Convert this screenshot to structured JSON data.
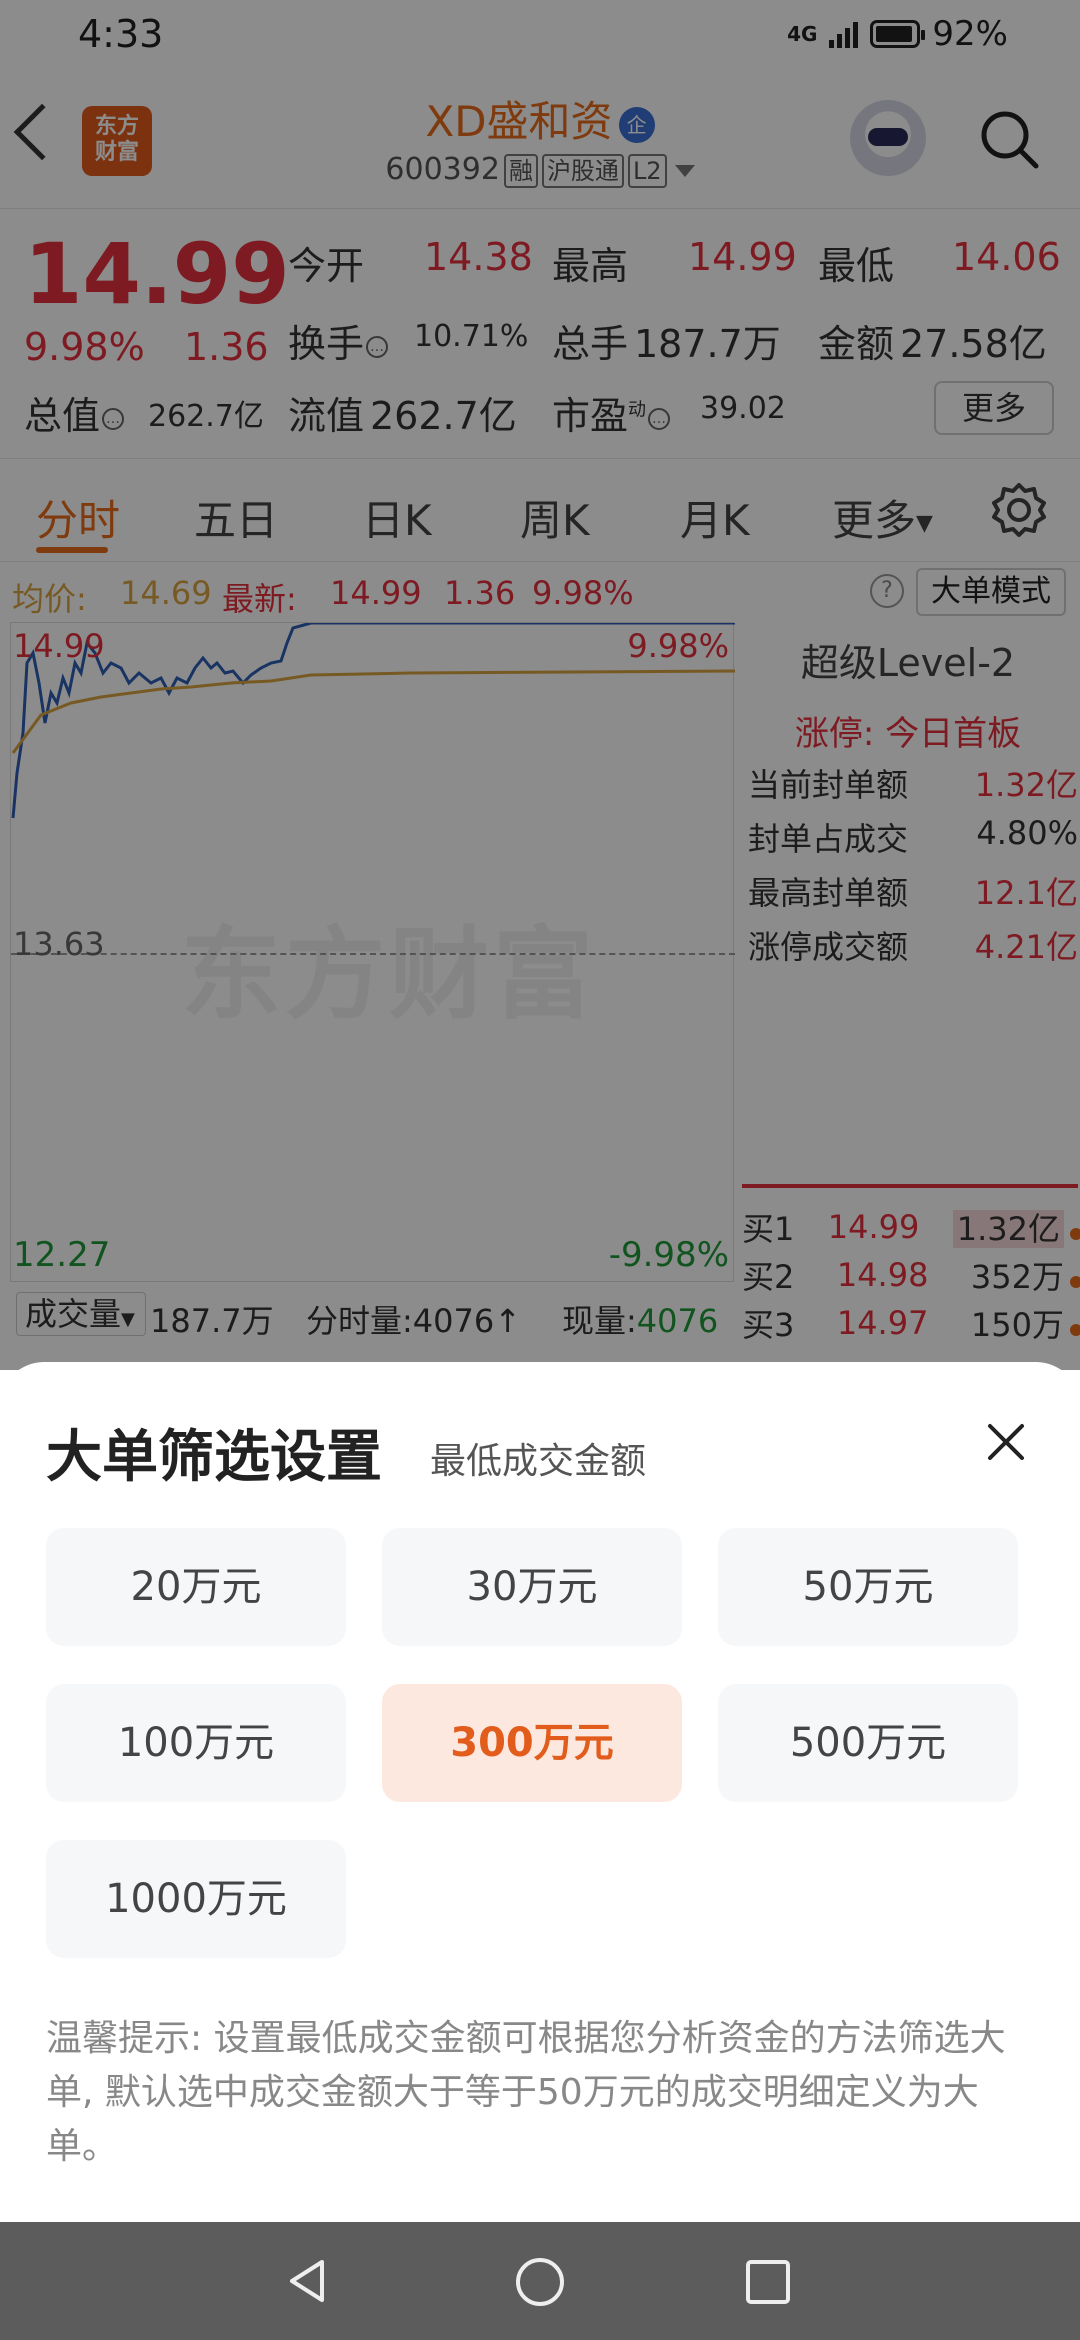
{
  "status_bar": {
    "time": "4:33",
    "signal": "4G",
    "battery": "92%"
  },
  "header": {
    "title": "XD盛和资",
    "title_badge": "企",
    "code": "600392",
    "tags": [
      "融",
      "沪股通",
      "L2"
    ],
    "logo_text_1": "东方",
    "logo_text_2": "财富"
  },
  "quote": {
    "price": "14.99",
    "change_pct": "9.98%",
    "change": "1.36",
    "open_label": "今开",
    "open": "14.38",
    "high_label": "最高",
    "high": "14.99",
    "low_label": "最低",
    "low": "14.06",
    "turnover_label": "换手",
    "turnover": "10.71%",
    "volume_label": "总手",
    "volume": "187.7万",
    "amount_label": "金额",
    "amount": "27.58亿",
    "mktcap_label": "总值",
    "mktcap": "262.7亿",
    "float_label": "流值",
    "float": "262.7亿",
    "pe_label": "市盈",
    "pe_sup": "动",
    "pe": "39.02",
    "more": "更多"
  },
  "tabs": [
    "分时",
    "五日",
    "日K",
    "周K",
    "月K",
    "更多"
  ],
  "chart_info": {
    "avg_label": "均价:",
    "avg": "14.69",
    "latest_label": "最新:",
    "latest": "14.99",
    "latest_change": "1.36",
    "latest_pct": "9.98%",
    "mode_btn": "大单模式"
  },
  "chart_labels": {
    "top_price": "14.99",
    "top_pct": "9.98%",
    "mid_price": "13.63",
    "bottom_price": "12.27",
    "bottom_pct": "-9.98%",
    "watermark": "东方财富"
  },
  "right_panel": {
    "level": "超级Level-2",
    "limit_up": "涨停: 今日首板",
    "rows": [
      {
        "label": "当前封单额",
        "value": "1.32亿"
      },
      {
        "label": "封单占成交",
        "value": "4.80%"
      },
      {
        "label": "最高封单额",
        "value": "12.1亿"
      },
      {
        "label": "涨停成交额",
        "value": "4.21亿"
      }
    ],
    "order_book": [
      {
        "label": "买1",
        "price": "14.99",
        "qty": "1.32亿"
      },
      {
        "label": "买2",
        "price": "14.98",
        "qty": "352万"
      },
      {
        "label": "买3",
        "price": "14.97",
        "qty": "150万"
      }
    ]
  },
  "volume_line": {
    "select": "成交量",
    "total": "187.7万",
    "tick_label": "分时量:4076↑",
    "now_label": "现量:",
    "now": "4076"
  },
  "sheet": {
    "title": "大单筛选设置",
    "subtitle": "最低成交金额",
    "options": [
      "20万元",
      "30万元",
      "50万元",
      "100万元",
      "300万元",
      "500万元",
      "1000万元"
    ],
    "selected": "300万元",
    "tip": "温馨提示: 设置最低成交金额可根据您分析资金的方法筛选大单, 默认选中成交金额大于等于50万元的成交明细定义为大单。"
  },
  "colors": {
    "accent": "#e76b1a",
    "up": "#e5303c",
    "down": "#1f9a3a",
    "selected_bg": "#fde8df"
  }
}
